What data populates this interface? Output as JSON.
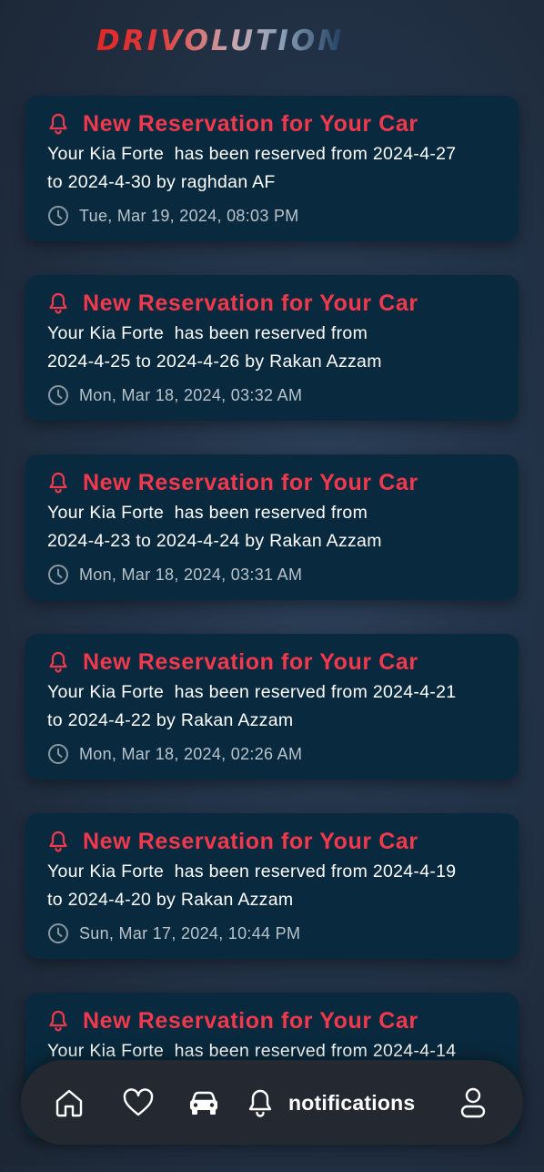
{
  "app": {
    "logo_text": "DRIVOLUTION"
  },
  "notifications": [
    {
      "title": "New Reservation for Your Car",
      "body": "Your Kia Forte  has been reserved from 2024-4-27 to 2024-4-30 by raghdan AF",
      "body_lines": [
        "Your Kia Forte  has been reserved from 2024-4-27",
        "to 2024-4-30 by raghdan AF"
      ],
      "time": "Tue, Mar 19, 2024, 08:03 PM"
    },
    {
      "title": "New Reservation for Your Car",
      "body": "Your Kia Forte  has been reserved from 2024-4-25 to 2024-4-26 by Rakan Azzam",
      "body_lines": [
        "Your Kia Forte  has been reserved from",
        "2024-4-25 to 2024-4-26 by Rakan Azzam"
      ],
      "time": "Mon, Mar 18, 2024, 03:32 AM"
    },
    {
      "title": "New Reservation for Your Car",
      "body": "Your Kia Forte  has been reserved from 2024-4-23 to 2024-4-24 by Rakan Azzam",
      "body_lines": [
        "Your Kia Forte  has been reserved from",
        "2024-4-23 to 2024-4-24 by Rakan Azzam"
      ],
      "time": "Mon, Mar 18, 2024, 03:31 AM"
    },
    {
      "title": "New Reservation for Your Car",
      "body": "Your Kia Forte  has been reserved from 2024-4-21 to 2024-4-22 by Rakan Azzam",
      "body_lines": [
        "Your Kia Forte  has been reserved from 2024-4-21",
        "to 2024-4-22 by Rakan Azzam"
      ],
      "time": "Mon, Mar 18, 2024, 02:26 AM"
    },
    {
      "title": "New Reservation for Your Car",
      "body": "Your Kia Forte  has been reserved from 2024-4-19 to 2024-4-20 by Rakan Azzam",
      "body_lines": [
        "Your Kia Forte  has been reserved from 2024-4-19",
        "to 2024-4-20 by Rakan Azzam"
      ],
      "time": "Sun, Mar 17, 2024, 10:44 PM"
    },
    {
      "title": "New Reservation for Your Car",
      "body": "Your Kia Forte  has been reserved from 2024-4-14",
      "body_lines": [
        "Your Kia Forte  has been reserved from 2024-4-14",
        ""
      ],
      "time": ""
    }
  ],
  "bottom_nav": {
    "items": [
      {
        "name": "home",
        "icon": "home-icon"
      },
      {
        "name": "favorites",
        "icon": "heart-icon"
      },
      {
        "name": "cars",
        "icon": "car-icon"
      },
      {
        "name": "notifications",
        "icon": "bell-icon",
        "label": "notifications",
        "active": true
      },
      {
        "name": "profile",
        "icon": "user-icon"
      }
    ],
    "active_label": "notifications"
  },
  "colors": {
    "card_bg": "#092a3e",
    "title_red": "#f0394c",
    "nav_bg": "#242830"
  }
}
